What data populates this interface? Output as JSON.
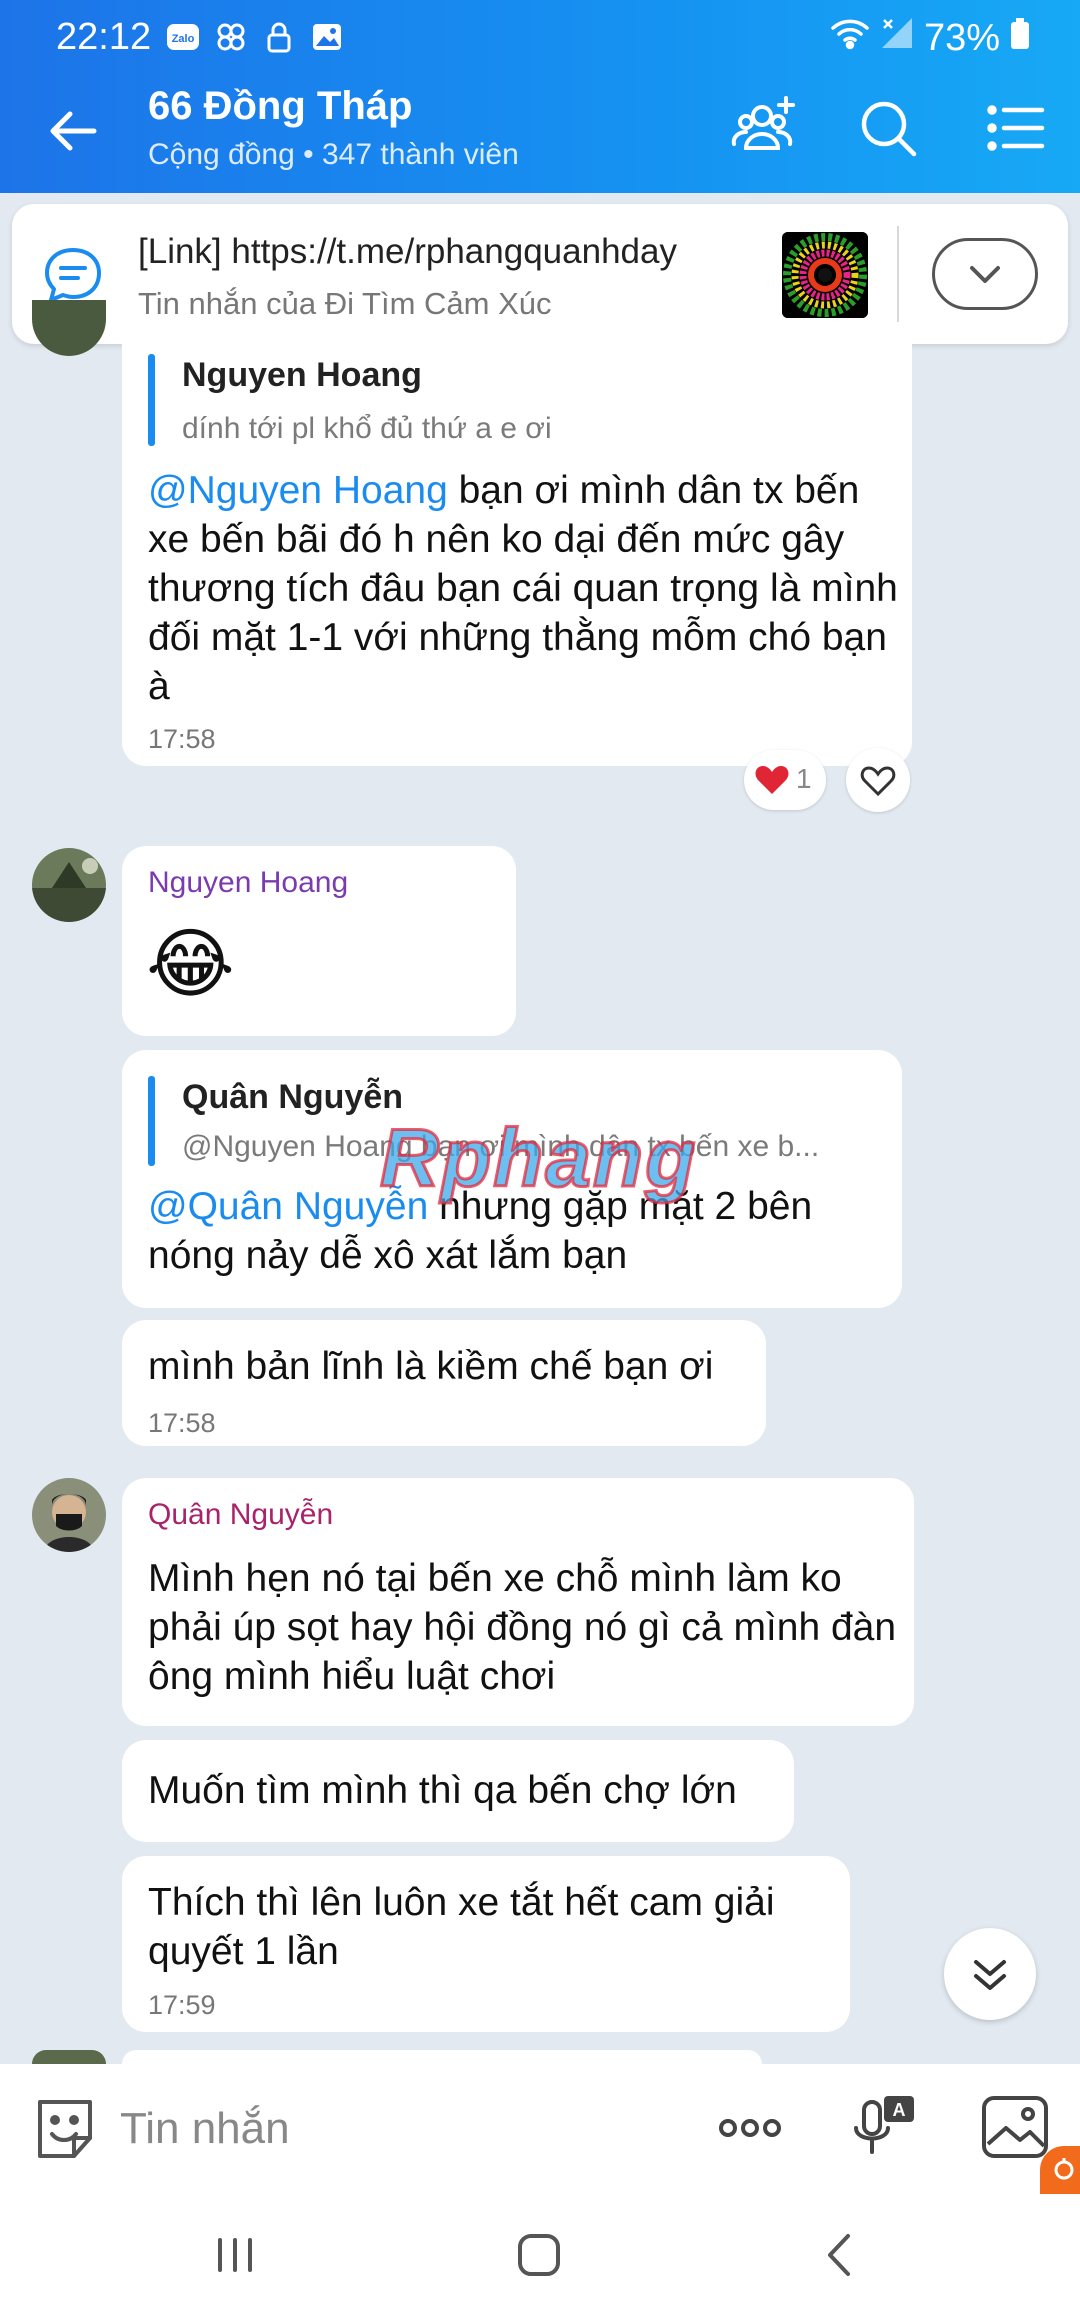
{
  "status_bar": {
    "time": "22:12",
    "battery": "73%",
    "app_icons": [
      "zalo-icon",
      "pinwheel-icon",
      "lock-icon",
      "image-icon"
    ]
  },
  "header": {
    "title": "66 Đồng Tháp",
    "subtitle": "Cộng đồng • 347 thành viên",
    "accent_color": "#1a8cf0"
  },
  "pinned": {
    "title": "[Link] https://t.me/rphangquanhday",
    "subtitle": "Tin nhắn của Đi Tìm Cảm Xúc"
  },
  "messages": {
    "m1": {
      "quote_name": "Nguyen Hoang",
      "quote_text": "dính tới pl khổ đủ thứ a e ơi",
      "mention": "@Nguyen Hoang",
      "text": " bạn ơi mình dân tx bến xe bến bãi đó h nên ko dại đến mức gây thương tích đâu bạn cái quan trọng là mình đối mặt 1-1 với những thằng mỗm chó bạn à",
      "time": "17:58",
      "reaction_count": "1"
    },
    "m2": {
      "sender": "Nguyen Hoang",
      "emoji": "😂"
    },
    "m3": {
      "quote_name": "Quân Nguyễn",
      "quote_text": "@Nguyen Hoang bạn ơi mình dân tx bến xe b...",
      "mention": "@Quân Nguyễn",
      "text": " nhưng gặp mặt 2 bên nóng nảy dễ xô xát lắm bạn"
    },
    "m4": {
      "text": "mình bản lĩnh là kiềm chế bạn ơi",
      "time": "17:58"
    },
    "m5": {
      "sender": "Quân Nguyễn",
      "text": "Mình hẹn nó tại bến xe chỗ mình làm ko phải úp sọt hay hội đồng nó gì cả mình đàn ông mình hiểu luật chơi"
    },
    "m6": {
      "text": "Muốn tìm mình thì qa bến chợ lớn"
    },
    "m7": {
      "text": "Thích thì lên luôn xe tắt hết cam giải quyết 1 lần",
      "time": "17:59"
    }
  },
  "watermark": "Rphang",
  "input": {
    "placeholder": "Tin nhắn"
  }
}
